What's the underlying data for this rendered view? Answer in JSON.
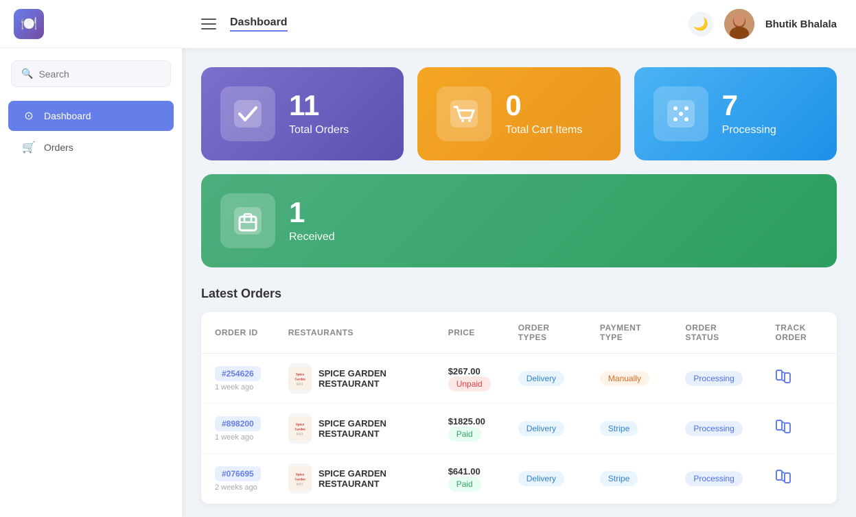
{
  "sidebar": {
    "logo_emoji": "🍽️",
    "search_placeholder": "Search",
    "nav_items": [
      {
        "id": "dashboard",
        "label": "Dashboard",
        "icon": "⊙",
        "active": true
      },
      {
        "id": "orders",
        "label": "Orders",
        "icon": "🛒",
        "active": false
      }
    ]
  },
  "topbar": {
    "page_title": "Dashboard",
    "dark_mode_icon": "🌙",
    "user_name": "Bhutik Bhalala",
    "user_avatar_emoji": "👩"
  },
  "stats": {
    "total_orders": {
      "value": "11",
      "label": "Total Orders",
      "icon": "✓"
    },
    "total_cart": {
      "value": "0",
      "label": "Total Cart Items",
      "icon": "🛒"
    },
    "processing": {
      "value": "7",
      "label": "Processing",
      "icon": "🎲"
    },
    "received": {
      "value": "1",
      "label": "Received",
      "icon": "📦"
    }
  },
  "latest_orders": {
    "title": "Latest Orders",
    "columns": [
      "ORDER ID",
      "RESTAURANTS",
      "PRICE",
      "ORDER TYPES",
      "PAYMENT TYPE",
      "ORDER STATUS",
      "TRACK ORDER"
    ],
    "rows": [
      {
        "order_id": "#254626",
        "time": "1 week ago",
        "restaurant_name": "SPICE GARDEN RESTAURANT",
        "restaurant_abbr": "Spice\nGarden",
        "price": "$267.00",
        "payment_status": "Unpaid",
        "order_type": "Delivery",
        "payment_type": "Manually",
        "order_status": "Processing"
      },
      {
        "order_id": "#898200",
        "time": "1 week ago",
        "restaurant_name": "SPICE GARDEN RESTAURANT",
        "restaurant_abbr": "Spice\nGarden",
        "price": "$1825.00",
        "payment_status": "Paid",
        "order_type": "Delivery",
        "payment_type": "Stripe",
        "order_status": "Processing"
      },
      {
        "order_id": "#076695",
        "time": "2 weeks ago",
        "restaurant_name": "SPICE GARDEN RESTAURANT",
        "restaurant_abbr": "Spice\nGarden",
        "price": "$641.00",
        "payment_status": "Paid",
        "order_type": "Delivery",
        "payment_type": "Stripe",
        "order_status": "Processing"
      }
    ]
  }
}
